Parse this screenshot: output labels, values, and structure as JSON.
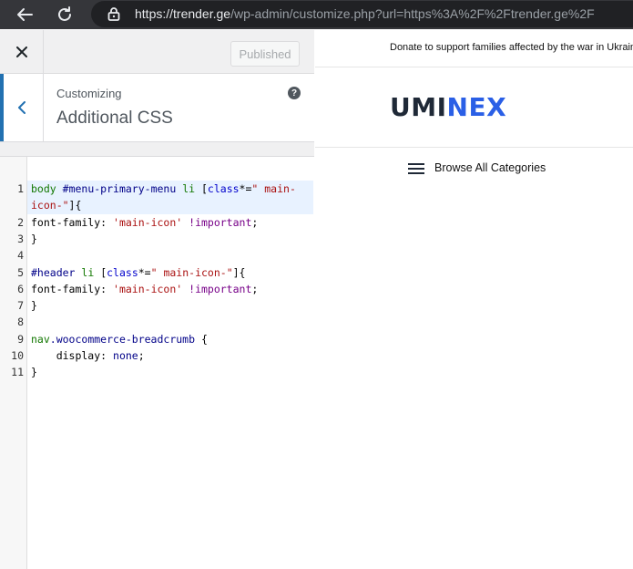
{
  "browser": {
    "url_host": "https://trender.ge",
    "url_path": "/wp-admin/customize.php?url=https%3A%2F%2Ftrender.ge%2F",
    "icons": [
      "back-arrow-icon",
      "reload-icon",
      "lock-icon"
    ]
  },
  "customizer": {
    "publish_label": "Published",
    "section_subtitle": "Customizing",
    "section_title": "Additional CSS",
    "help_glyph": "?",
    "accent_color": "#2271b1"
  },
  "editor": {
    "line_numbers": [
      "1",
      "",
      "2",
      "3",
      "4",
      "5",
      "6",
      "7",
      "8",
      "9",
      "10",
      "11"
    ],
    "lines": [
      {
        "tokens": [
          {
            "t": "body",
            "c": "tag"
          },
          {
            "t": " ",
            "c": "plain"
          },
          {
            "t": "#menu-primary-menu",
            "c": "id"
          },
          {
            "t": " ",
            "c": "plain"
          },
          {
            "t": "li",
            "c": "tag"
          },
          {
            "t": " [",
            "c": "plain"
          },
          {
            "t": "class",
            "c": "attr"
          },
          {
            "t": "*=",
            "c": "plain"
          },
          {
            "t": "\" main-",
            "c": "str"
          }
        ]
      },
      {
        "tokens": [
          {
            "t": "icon-\"",
            "c": "str"
          },
          {
            "t": "]{",
            "c": "plain"
          }
        ]
      },
      {
        "tokens": [
          {
            "t": "font-family",
            "c": "prop"
          },
          {
            "t": ": ",
            "c": "plain"
          },
          {
            "t": "'main-icon'",
            "c": "str"
          },
          {
            "t": " ",
            "c": "plain"
          },
          {
            "t": "!important",
            "c": "kw"
          },
          {
            "t": ";",
            "c": "plain"
          }
        ]
      },
      {
        "tokens": [
          {
            "t": "}",
            "c": "plain"
          }
        ]
      },
      {
        "tokens": []
      },
      {
        "tokens": [
          {
            "t": "#header",
            "c": "id"
          },
          {
            "t": " ",
            "c": "plain"
          },
          {
            "t": "li",
            "c": "tag"
          },
          {
            "t": " [",
            "c": "plain"
          },
          {
            "t": "class",
            "c": "attr"
          },
          {
            "t": "*=",
            "c": "plain"
          },
          {
            "t": "\" main-icon-\"",
            "c": "str"
          },
          {
            "t": "]{",
            "c": "plain"
          }
        ]
      },
      {
        "tokens": [
          {
            "t": "font-family",
            "c": "prop"
          },
          {
            "t": ": ",
            "c": "plain"
          },
          {
            "t": "'main-icon'",
            "c": "str"
          },
          {
            "t": " ",
            "c": "plain"
          },
          {
            "t": "!important",
            "c": "kw"
          },
          {
            "t": ";",
            "c": "plain"
          }
        ]
      },
      {
        "tokens": [
          {
            "t": "}",
            "c": "plain"
          }
        ]
      },
      {
        "tokens": []
      },
      {
        "tokens": [
          {
            "t": "nav",
            "c": "tag"
          },
          {
            "t": ".woocommerce-breadcrumb",
            "c": "id"
          },
          {
            "t": " {",
            "c": "plain"
          }
        ]
      },
      {
        "tokens": [
          {
            "t": "    display",
            "c": "prop"
          },
          {
            "t": ": ",
            "c": "plain"
          },
          {
            "t": "none",
            "c": "id"
          },
          {
            "t": ";",
            "c": "plain"
          }
        ]
      },
      {
        "tokens": [
          {
            "t": "}",
            "c": "plain"
          }
        ]
      }
    ]
  },
  "preview": {
    "topbar_text": "Donate to support families affected by the war in Ukraine",
    "logo_dark": "UMI",
    "logo_blue": "NE",
    "logo_x": "X",
    "browse_label": "Browse All Categories",
    "brand_blue": "#2a5fe6"
  }
}
